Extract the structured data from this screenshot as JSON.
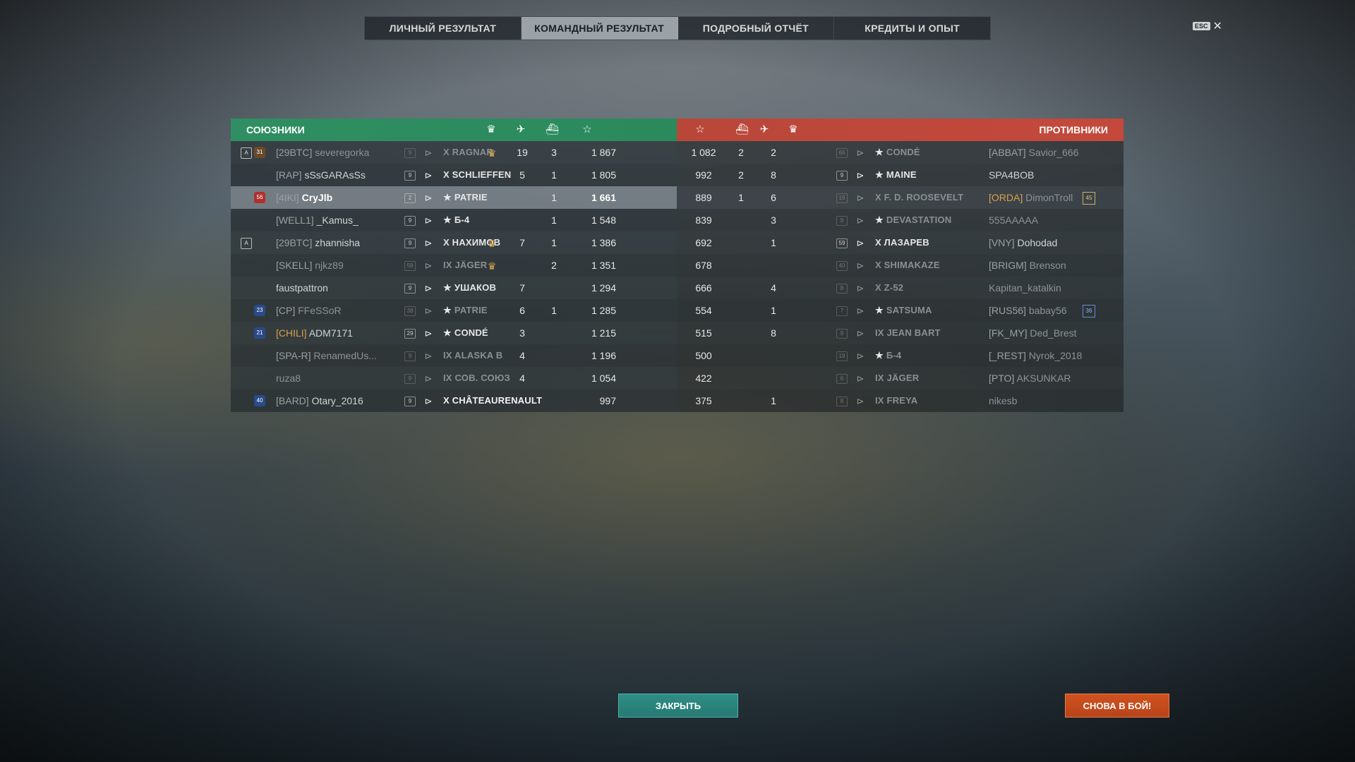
{
  "tabs": [
    "ЛИЧНЫЙ РЕЗУЛЬТАТ",
    "КОМАНДНЫЙ РЕЗУЛЬТАТ",
    "ПОДРОБНЫЙ ОТЧЁТ",
    "КРЕДИТЫ И ОПЫТ"
  ],
  "active_tab": 1,
  "esc_key": "ESC",
  "close_glyph": "✕",
  "allies_title": "СОЮЗНИКИ",
  "enemies_title": "ПРОТИВНИКИ",
  "column_icons": [
    "laurel-icon",
    "planes-icon",
    "ship-sink-icon",
    "star-icon"
  ],
  "allies": [
    {
      "clan": "[29BTC]",
      "name": "severegorka",
      "clan_gold": false,
      "dim": true,
      "div": "A",
      "tag": "31",
      "tag_color": "#6b4a2a",
      "lvl": "9",
      "ship_tier": "X",
      "ship": "RAGNAR",
      "ship_star": false,
      "ship_dim": true,
      "laurel": true,
      "planes": "19",
      "kills": "3",
      "xp": "1 867"
    },
    {
      "clan": "[RAP]",
      "name": "sSsGARAsSs",
      "dim": false,
      "lvl": "9",
      "ship_tier": "X",
      "ship": "SCHLIEFFEN",
      "ship_star": false,
      "planes": "5",
      "kills": "1",
      "xp": "1 805"
    },
    {
      "clan": "[4IKI]",
      "name": "CryJlb",
      "self": true,
      "tag": "56",
      "tag_color": "#b03030",
      "lvl": "2",
      "ship_tier": "",
      "ship": "PATRIE",
      "ship_star": true,
      "planes": "",
      "kills": "1",
      "xp": "1 661"
    },
    {
      "clan": "[WELL1]",
      "name": "_Kamus_",
      "lvl": "9",
      "ship_tier": "",
      "ship": "Б-4",
      "ship_star": true,
      "planes": "",
      "kills": "1",
      "xp": "1 548"
    },
    {
      "clan": "[29BTC]",
      "name": "zhannisha",
      "div": "A",
      "lvl": "9",
      "ship_tier": "X",
      "ship": "НАХИМОВ",
      "ship_star": false,
      "laurel": true,
      "planes": "7",
      "kills": "1",
      "xp": "1 386"
    },
    {
      "clan": "[SKELL]",
      "name": "njkz89",
      "dim": true,
      "lvl": "58",
      "ship_tier": "IX",
      "ship": "JÄGER",
      "ship_star": false,
      "ship_dim": true,
      "laurel": true,
      "planes": "",
      "kills": "2",
      "xp": "1 351"
    },
    {
      "clan": "",
      "name": "faustpattron",
      "lvl": "9",
      "ship_tier": "",
      "ship": "УШАКОВ",
      "ship_star": true,
      "planes": "7",
      "kills": "",
      "xp": "1 294"
    },
    {
      "clan": "[CP]",
      "name": "FFeSSoR",
      "dim": true,
      "tag": "23",
      "tag_color": "#2a4a8a",
      "lvl": "38",
      "ship_tier": "",
      "ship": "PATRIE",
      "ship_star": true,
      "ship_dim": true,
      "planes": "6",
      "kills": "1",
      "xp": "1 285"
    },
    {
      "clan": "[CHILI]",
      "name": "ADM7171",
      "clan_gold": true,
      "tag": "21",
      "tag_color": "#2a4a8a",
      "lvl": "29",
      "ship_tier": "",
      "ship": "CONDÉ",
      "ship_star": true,
      "planes": "3",
      "kills": "",
      "xp": "1 215"
    },
    {
      "clan": "[SPA-R]",
      "name": "RenamedUs...",
      "dim": true,
      "lvl": "9",
      "ship_tier": "IX",
      "ship": "ALASKA B",
      "ship_star": false,
      "ship_dim": true,
      "planes": "4",
      "kills": "",
      "xp": "1 196"
    },
    {
      "clan": "",
      "name": "ruza8",
      "dim": true,
      "lvl": "9",
      "ship_tier": "IX",
      "ship": "СОВ. СОЮЗ",
      "ship_star": false,
      "ship_dim": true,
      "planes": "4",
      "kills": "",
      "xp": "1 054"
    },
    {
      "clan": "[BARD]",
      "name": "Otary_2016",
      "tag": "40",
      "tag_color": "#2a4a8a",
      "lvl": "9",
      "ship_tier": "X",
      "ship": "CHÂTEAURENAULT",
      "ship_star": false,
      "ship_white": true,
      "planes": "",
      "kills": "",
      "xp": "997"
    }
  ],
  "enemies": [
    {
      "xp": "1 082",
      "kills": "2",
      "planes": "2",
      "lvl": "66",
      "ship_tier": "",
      "ship": "CONDÉ",
      "ship_star": true,
      "ship_dim": true,
      "clan": "[ABBAT]",
      "name": "Savior_666",
      "dim": true
    },
    {
      "xp": "992",
      "kills": "2",
      "planes": "8",
      "lvl": "9",
      "ship_tier": "",
      "ship": "MAINE",
      "ship_star": true,
      "clan": "",
      "name": "SPA4BOB"
    },
    {
      "xp": "889",
      "kills": "1",
      "planes": "6",
      "lvl": "19",
      "ship_tier": "X",
      "ship": "F. D. ROOSEVELT",
      "ship_star": false,
      "ship_dim": true,
      "clan": "[ORDA]",
      "name": "DimonTroll",
      "clan_gold": true,
      "dim": true,
      "badge": "45"
    },
    {
      "xp": "839",
      "kills": "",
      "planes": "3",
      "lvl": "9",
      "ship_tier": "",
      "ship": "DEVASTATION",
      "ship_star": true,
      "ship_dim": true,
      "clan": "",
      "name": "555AAAAA",
      "dim": true
    },
    {
      "xp": "692",
      "kills": "",
      "planes": "1",
      "lvl": "59",
      "ship_tier": "X",
      "ship": "ЛАЗАРЕВ",
      "ship_star": false,
      "clan": "[VNY]",
      "name": "Dohodad"
    },
    {
      "xp": "678",
      "kills": "",
      "planes": "",
      "lvl": "40",
      "ship_tier": "X",
      "ship": "SHIMAKAZE",
      "ship_star": false,
      "ship_dim": true,
      "clan": "[BRIGM]",
      "name": "Brenson",
      "dim": true
    },
    {
      "xp": "666",
      "kills": "",
      "planes": "4",
      "lvl": "8",
      "ship_tier": "X",
      "ship": "Z-52",
      "ship_star": false,
      "ship_dim": true,
      "clan": "",
      "name": "Kapitan_katalkin",
      "dim": true
    },
    {
      "xp": "554",
      "kills": "",
      "planes": "1",
      "lvl": "7",
      "ship_tier": "",
      "ship": "SATSUMA",
      "ship_star": true,
      "ship_dim": true,
      "clan": "[RUS56]",
      "name": "babay56",
      "dim": true,
      "badge": "36",
      "badge_blue": true
    },
    {
      "xp": "515",
      "kills": "",
      "planes": "8",
      "lvl": "9",
      "ship_tier": "IX",
      "ship": "JEAN BART",
      "ship_star": false,
      "ship_dim": true,
      "clan": "[FK_MY]",
      "name": "Ded_Brest",
      "dim": true
    },
    {
      "xp": "500",
      "kills": "",
      "planes": "",
      "lvl": "19",
      "ship_tier": "",
      "ship": "Б-4",
      "ship_star": true,
      "ship_dim": true,
      "clan": "[_REST]",
      "name": "Nyrok_2018",
      "dim": true
    },
    {
      "xp": "422",
      "kills": "",
      "planes": "",
      "lvl": "6",
      "ship_tier": "IX",
      "ship": "JÄGER",
      "ship_star": false,
      "ship_dim": true,
      "clan": "[PTO]",
      "name": "AKSUNKAR",
      "dim": true
    },
    {
      "xp": "375",
      "kills": "",
      "planes": "1",
      "lvl": "8",
      "ship_tier": "IX",
      "ship": "FREYA",
      "ship_star": false,
      "ship_dim": true,
      "clan": "",
      "name": "nikesb",
      "dim": true
    }
  ],
  "buttons": {
    "close": "ЗАКРЫТЬ",
    "battle": "СНОВА В БОЙ!"
  }
}
